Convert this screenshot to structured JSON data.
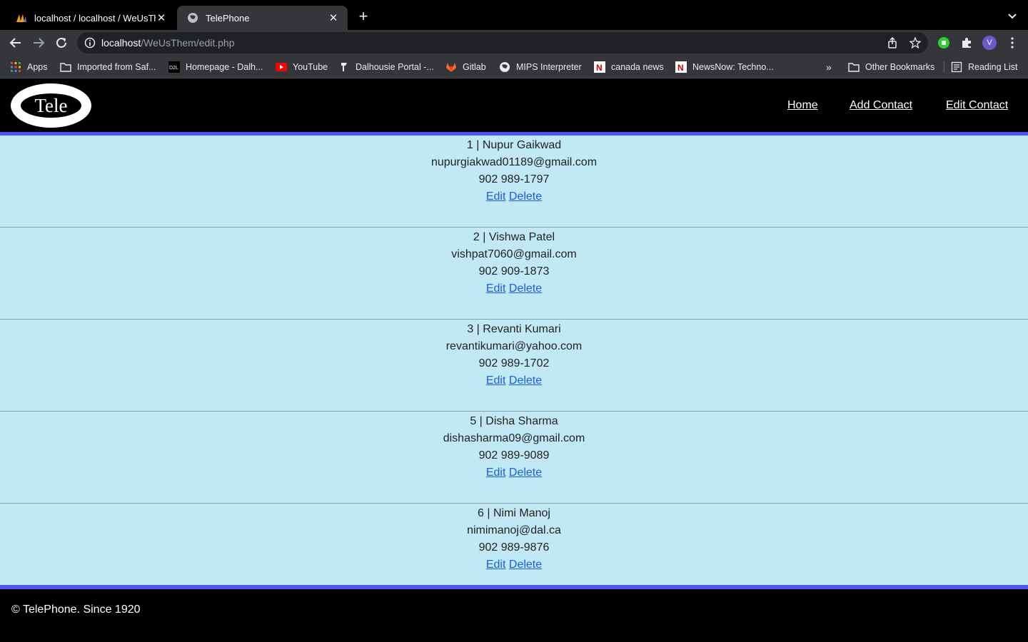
{
  "browser": {
    "tabs": [
      {
        "title": "localhost / localhost / WeUsThe",
        "icon": "phpmyadmin-icon",
        "active": false
      },
      {
        "title": "TelePhone",
        "icon": "globe-icon",
        "active": true
      }
    ],
    "url_host": "localhost",
    "url_path": "/WeUsThem/edit.php",
    "profile_initial": "V",
    "bookmarks": [
      {
        "label": "Apps",
        "icon": "apps-grid-icon"
      },
      {
        "label": "Imported from Saf...",
        "icon": "folder-icon"
      },
      {
        "label": "Homepage - Dalh...",
        "icon": "d2l-icon"
      },
      {
        "label": "YouTube",
        "icon": "youtube-icon"
      },
      {
        "label": "Dalhousie Portal -...",
        "icon": "dal-icon"
      },
      {
        "label": "Gitlab",
        "icon": "gitlab-icon"
      },
      {
        "label": "MIPS Interpreter",
        "icon": "globe-icon"
      },
      {
        "label": "canada news",
        "icon": "newsnow-icon"
      },
      {
        "label": "NewsNow: Techno...",
        "icon": "newsnow-icon"
      }
    ],
    "overflow": "»",
    "other_bookmarks": "Other Bookmarks",
    "reading_list": "Reading List"
  },
  "site": {
    "logo_text": "Tele",
    "nav": {
      "home": "Home",
      "add": "Add Contact",
      "edit": "Edit Contact"
    },
    "contacts": [
      {
        "heading": "1 | Nupur Gaikwad",
        "email": "nupurgiakwad01189@gmail.com",
        "phone": "902 989-1797"
      },
      {
        "heading": "2 | Vishwa Patel",
        "email": "vishpat7060@gmail.com",
        "phone": "902 909-1873"
      },
      {
        "heading": "3 | Revanti Kumari",
        "email": "revantikumari@yahoo.com",
        "phone": "902 989-1702"
      },
      {
        "heading": "5 | Disha Sharma",
        "email": "dishasharma09@gmail.com",
        "phone": "902 989-9089"
      },
      {
        "heading": "6 | Nimi Manoj",
        "email": "nimimanoj@dal.ca",
        "phone": "902 989-9876"
      }
    ],
    "edit_label": "Edit",
    "delete_label": "Delete",
    "footer": "© TelePhone. Since 1920"
  },
  "colors": {
    "content_bg": "#c1e9f5",
    "accent": "#4f56f0",
    "link": "#1a5fd6"
  }
}
